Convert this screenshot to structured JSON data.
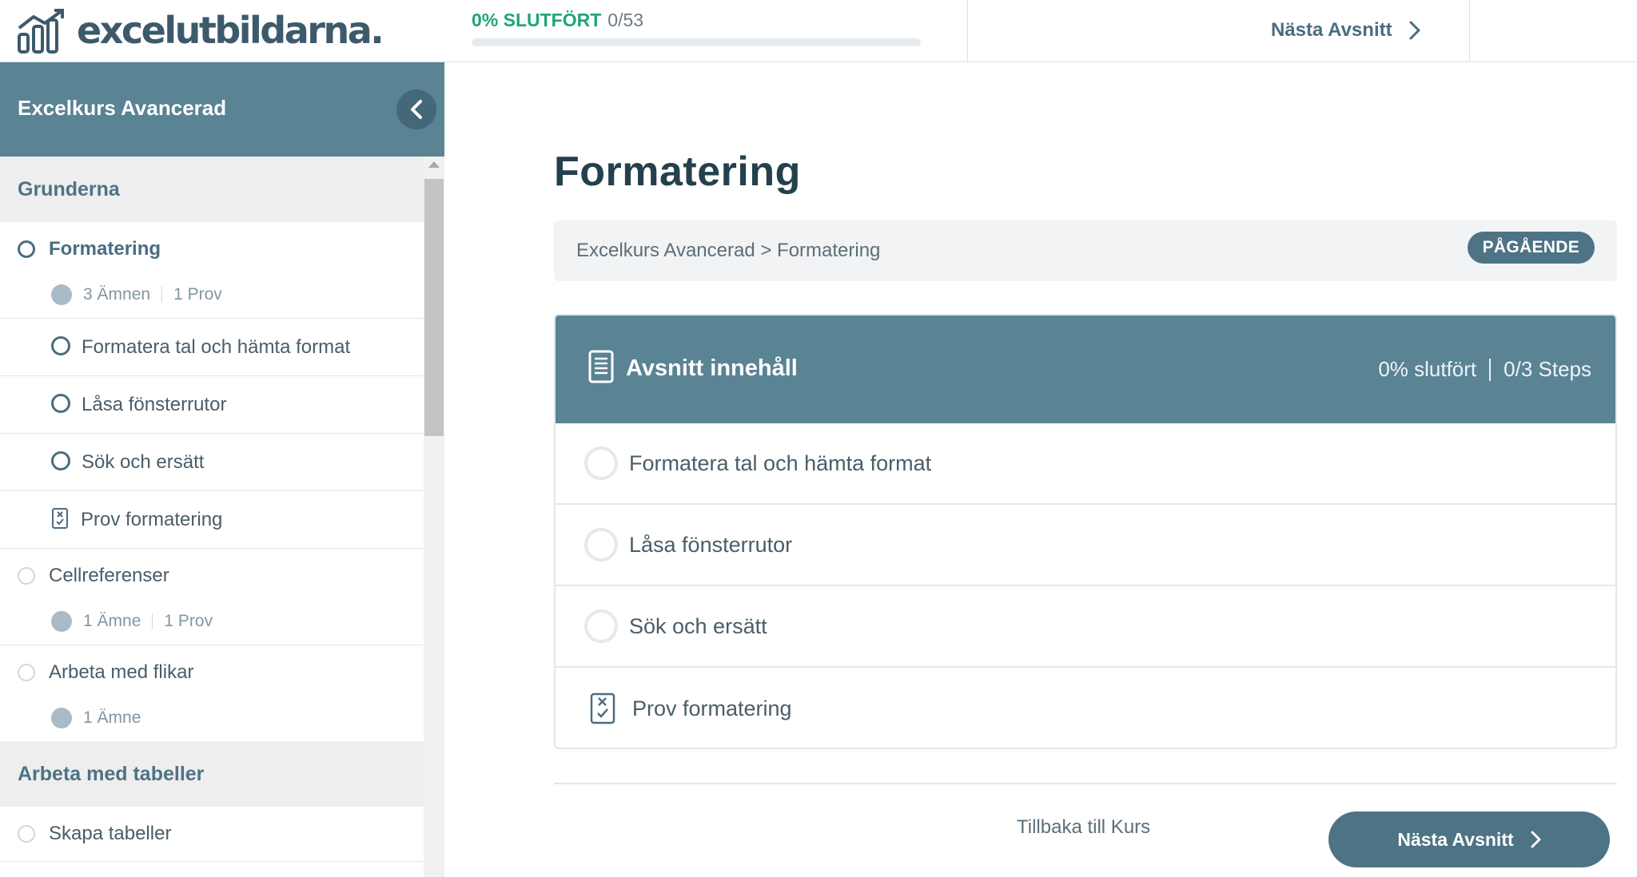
{
  "header": {
    "logo_text": "excelutbildarna.",
    "progress_label": "0% SLUTFÖRT",
    "progress_count": "0/53",
    "progress_fraction": 0.0,
    "next_label": "Nästa Avsnitt"
  },
  "sidebar": {
    "course_title": "Excelkurs Avancerad",
    "sections": [
      {
        "title": "Grunderna",
        "lessons": [
          {
            "label": "Formatering",
            "active": true,
            "meta_topics": "3 Ämnen",
            "meta_quiz": "1 Prov",
            "topics": [
              {
                "label": "Formatera tal och hämta format",
                "type": "topic"
              },
              {
                "label": "Låsa fönsterrutor",
                "type": "topic"
              },
              {
                "label": "Sök och ersätt",
                "type": "topic"
              },
              {
                "label": "Prov formatering",
                "type": "quiz"
              }
            ]
          },
          {
            "label": "Cellreferenser",
            "meta_topics": "1 Ämne",
            "meta_quiz": "1 Prov"
          },
          {
            "label": "Arbeta med flikar",
            "meta_topics": "1 Ämne"
          }
        ]
      },
      {
        "title": "Arbeta med tabeller",
        "lessons": [
          {
            "label": "Skapa tabeller"
          }
        ]
      }
    ]
  },
  "main": {
    "title": "Formatering",
    "breadcrumb": "Excelkurs Avancerad > Formatering",
    "status_badge": "PÅGÅENDE",
    "content": {
      "heading": "Avsnitt innehåll",
      "stats_percent": "0% slutfört",
      "stats_steps": "0/3 Steps",
      "items": [
        {
          "label": "Formatera tal och hämta format",
          "type": "topic"
        },
        {
          "label": "Låsa fönsterrutor",
          "type": "topic"
        },
        {
          "label": "Sök och ersätt",
          "type": "topic"
        },
        {
          "label": "Prov formatering",
          "type": "quiz"
        }
      ]
    },
    "back_label": "Tillbaka till Kurs",
    "next_label": "Nästa Avsnitt"
  },
  "colors": {
    "brand_teal": "#5a8394",
    "brand_dark": "#4e7385",
    "progress_green": "#1fa37d",
    "title_dark": "#24404d"
  }
}
